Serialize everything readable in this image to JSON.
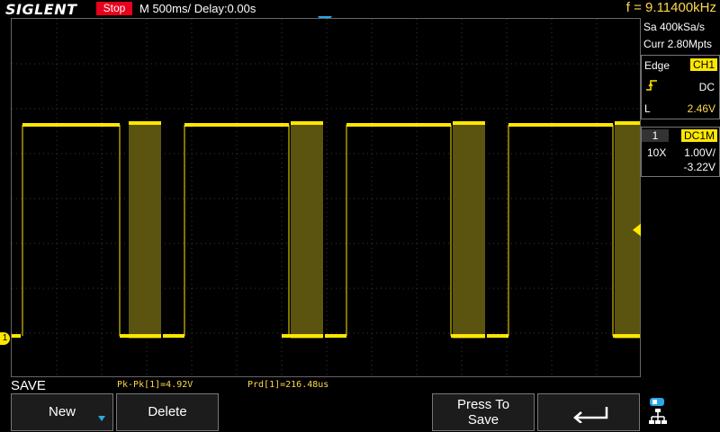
{
  "header": {
    "brand": "SIGLENT",
    "status": "Stop",
    "timebase": "M 500ms/",
    "delay": "Delay:0.00s",
    "frequency": "f = 9.11400kHz"
  },
  "acquisition": {
    "sample_rate": "Sa 400kSa/s",
    "memory": "Curr 2.80Mpts"
  },
  "trigger": {
    "type_label": "Edge",
    "source": "CH1",
    "coupling": "DC",
    "level_label": "L",
    "level_value": "2.46V"
  },
  "channel": {
    "number": "1",
    "coupling": "DC1M",
    "probe": "10X",
    "scale": "1.00V/",
    "offset": "-3.22V",
    "marker": "1"
  },
  "save_menu": {
    "title": "SAVE",
    "new_label": "New",
    "delete_label": "Delete",
    "press_to": "Press To",
    "save_label": "Save"
  },
  "measurements": {
    "pkpk": "Pk-Pk[1]=4.92V",
    "period": "Prd[1]=216.48us"
  },
  "colors": {
    "trace": "#ffe700",
    "status_bg": "#e8001c",
    "accent": "#2aa7e8"
  },
  "icons": {
    "back": "return-arrow-icon",
    "network": "network-icon"
  }
}
